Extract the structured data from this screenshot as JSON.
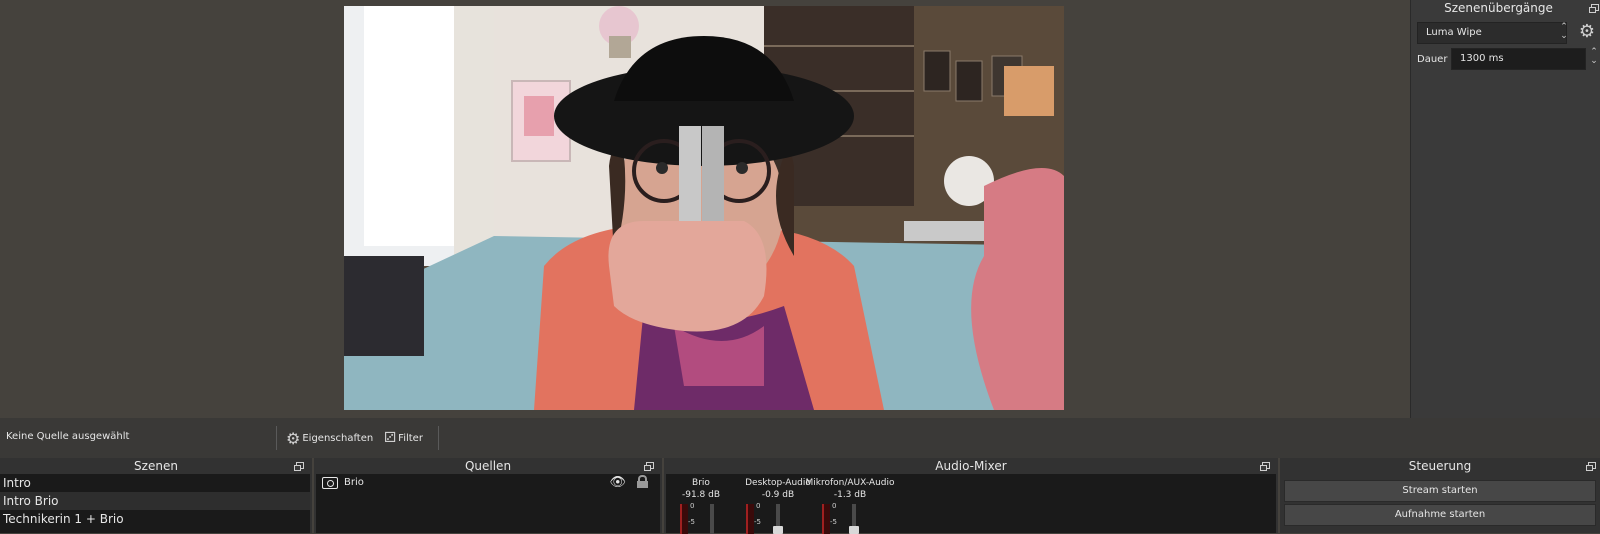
{
  "transitions": {
    "title": "Szenenübergänge",
    "selected": "Luma Wipe",
    "duration_label": "Dauer",
    "duration_value": "1300 ms"
  },
  "source_toolbar": {
    "status": "Keine Quelle ausgewählt",
    "properties_label": "Eigenschaften",
    "filters_label": "Filter"
  },
  "scenes": {
    "title": "Szenen",
    "items": [
      "Intro",
      "Intro Brio",
      "Technikerin 1 + Brio"
    ],
    "selected_index": 1
  },
  "sources": {
    "title": "Quellen",
    "items": [
      {
        "label": "Brio",
        "icon": "camera-icon"
      }
    ]
  },
  "mixer": {
    "title": "Audio-Mixer",
    "channels": [
      {
        "name": "Brio",
        "db": "-91.8 dB"
      },
      {
        "name": "Desktop-Audio",
        "db": "-0.9 dB"
      },
      {
        "name": "Mikrofon/AUX-Audio",
        "db": "-1.3 dB"
      }
    ],
    "meter_ticks": [
      "0",
      "-5"
    ]
  },
  "controls": {
    "title": "Steuerung",
    "stream_label": "Stream starten",
    "record_label": "Aufnahme starten"
  },
  "colors": {
    "background": "#45423d",
    "dock_bg": "#323232",
    "list_bg": "#1a1a1a",
    "button_bg": "#474747"
  }
}
